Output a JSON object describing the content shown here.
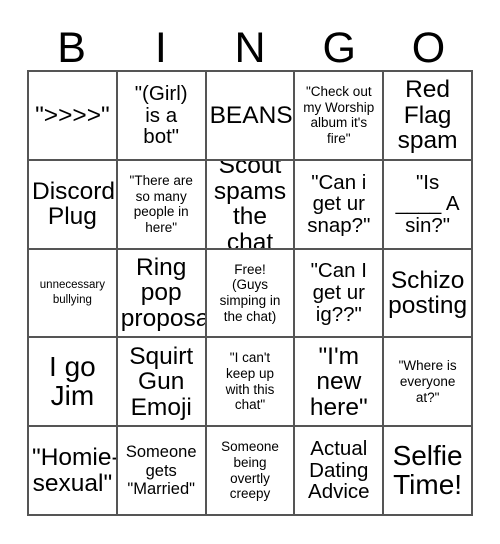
{
  "title": "BINGO",
  "header": {
    "letters": [
      "B",
      "I",
      "N",
      "G",
      "O"
    ]
  },
  "grid": {
    "rows": 5,
    "columns": 5,
    "border_color": "#555555",
    "background": "#ffffff",
    "text_color": "#000000"
  },
  "cells": [
    {
      "id": "b1",
      "column": "B",
      "row": 1,
      "text": "\">>>>\"",
      "size": "xl"
    },
    {
      "id": "i1",
      "column": "I",
      "row": 1,
      "text": "\"(Girl)\nis a\nbot\"",
      "size": "l"
    },
    {
      "id": "n1",
      "column": "N",
      "row": 1,
      "text": "BEANS",
      "size": "xl"
    },
    {
      "id": "g1",
      "column": "G",
      "row": 1,
      "text": "\"Check out\nmy Worship\nalbum it's\nfire\"",
      "size": "s"
    },
    {
      "id": "o1",
      "column": "O",
      "row": 1,
      "text": "Red\nFlag\nspam",
      "size": "xl"
    },
    {
      "id": "b2",
      "column": "B",
      "row": 2,
      "text": "Discord\nPlug",
      "size": "xl"
    },
    {
      "id": "i2",
      "column": "I",
      "row": 2,
      "text": "\"There are\nso many\npeople in\nhere\"",
      "size": "s"
    },
    {
      "id": "n2",
      "column": "N",
      "row": 2,
      "text": "Scout\nspams\nthe chat",
      "size": "xl"
    },
    {
      "id": "g2",
      "column": "G",
      "row": 2,
      "text": "\"Can i\nget ur\nsnap?\"",
      "size": "l"
    },
    {
      "id": "o2",
      "column": "O",
      "row": 2,
      "text": "\"Is\n____ A\nsin?\"",
      "size": "l"
    },
    {
      "id": "b3",
      "column": "B",
      "row": 3,
      "text": "unnecessary\nbullying",
      "size": "xs"
    },
    {
      "id": "i3",
      "column": "I",
      "row": 3,
      "text": "Ring\npop\nproposal",
      "size": "xl"
    },
    {
      "id": "n3",
      "column": "N",
      "row": 3,
      "text": "Free!\n(Guys\nsimping in\nthe chat)",
      "size": "s"
    },
    {
      "id": "g3",
      "column": "G",
      "row": 3,
      "text": "\"Can I\nget ur\nig??\"",
      "size": "l"
    },
    {
      "id": "o3",
      "column": "O",
      "row": 3,
      "text": "Schizo\nposting",
      "size": "xl"
    },
    {
      "id": "b4",
      "column": "B",
      "row": 4,
      "text": "I go\nJim",
      "size": "xxl"
    },
    {
      "id": "i4",
      "column": "I",
      "row": 4,
      "text": "Squirt\nGun\nEmoji",
      "size": "xl"
    },
    {
      "id": "n4",
      "column": "N",
      "row": 4,
      "text": "\"I can't\nkeep up\nwith this\nchat\"",
      "size": "s"
    },
    {
      "id": "g4",
      "column": "G",
      "row": 4,
      "text": "\"I'm\nnew\nhere\"",
      "size": "xl"
    },
    {
      "id": "o4",
      "column": "O",
      "row": 4,
      "text": "\"Where is\neveryone\nat?\"",
      "size": "s"
    },
    {
      "id": "b5",
      "column": "B",
      "row": 5,
      "text": "\"Homie-\nsexual\"",
      "size": "xl"
    },
    {
      "id": "i5",
      "column": "I",
      "row": 5,
      "text": "Someone\ngets\n\"Married\"",
      "size": "m"
    },
    {
      "id": "n5",
      "column": "N",
      "row": 5,
      "text": "Someone\nbeing\novertly\ncreepy",
      "size": "s"
    },
    {
      "id": "g5",
      "column": "G",
      "row": 5,
      "text": "Actual\nDating\nAdvice",
      "size": "l"
    },
    {
      "id": "o5",
      "column": "O",
      "row": 5,
      "text": "Selfie\nTime!",
      "size": "xxl"
    }
  ]
}
